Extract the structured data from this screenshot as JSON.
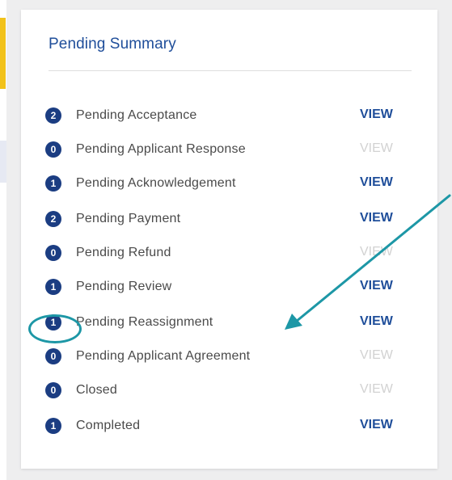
{
  "panel": {
    "title": "Pending Summary"
  },
  "items": [
    {
      "count": "2",
      "label": "Pending Acceptance",
      "action": "VIEW",
      "enabled": true
    },
    {
      "count": "0",
      "label": "Pending Applicant Response",
      "action": "VIEW",
      "enabled": false
    },
    {
      "count": "1",
      "label": "Pending Acknowledgement",
      "action": "VIEW",
      "enabled": true
    },
    {
      "count": "2",
      "label": "Pending Payment",
      "action": "VIEW",
      "enabled": true
    },
    {
      "count": "0",
      "label": "Pending Refund",
      "action": "VIEW",
      "enabled": false
    },
    {
      "count": "1",
      "label": "Pending Review",
      "action": "VIEW",
      "enabled": true
    },
    {
      "count": "1",
      "label": "Pending Reassignment",
      "action": "VIEW",
      "enabled": true
    },
    {
      "count": "0",
      "label": "Pending Applicant Agreement",
      "action": "VIEW",
      "enabled": false
    },
    {
      "count": "0",
      "label": "Closed",
      "action": "VIEW",
      "enabled": false
    },
    {
      "count": "1",
      "label": "Completed",
      "action": "VIEW",
      "enabled": true
    }
  ],
  "colors": {
    "accent": "#1f4e9a",
    "badge": "#1b3d82",
    "disabled": "#d2d2d2",
    "annotation": "#1d97a6",
    "side_accent": "#f2c21a"
  }
}
